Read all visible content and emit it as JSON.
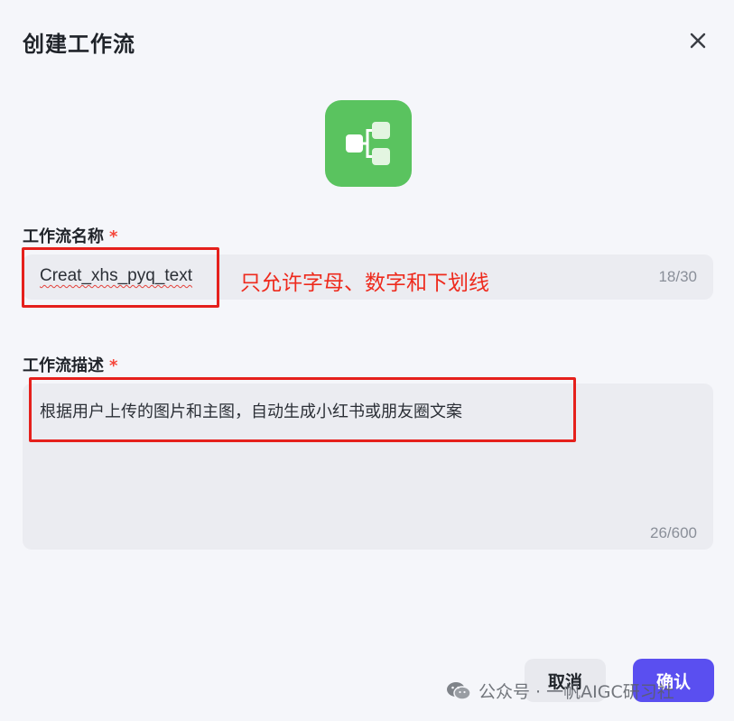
{
  "dialog": {
    "title": "创建工作流",
    "close_icon": "close-icon",
    "app_icon": "workflow-icon",
    "app_icon_color": "#5ac35f"
  },
  "name_field": {
    "label": "工作流名称",
    "required_mark": "*",
    "value": "Creat_xhs_pyq_text",
    "counter": "18/30"
  },
  "desc_field": {
    "label": "工作流描述",
    "required_mark": "*",
    "value": "根据用户上传的图片和主图，自动生成小红书或朋友圈文案",
    "counter": "26/600"
  },
  "annotation": {
    "note": "只允许字母、数字和下划线",
    "color": "#e5201c"
  },
  "footer": {
    "cancel_label": "取消",
    "confirm_label": "确认",
    "confirm_color": "#5a4ff0"
  },
  "watermark": {
    "text": "公众号 · 一帆AIGC研习社",
    "icon": "wechat-icon"
  }
}
